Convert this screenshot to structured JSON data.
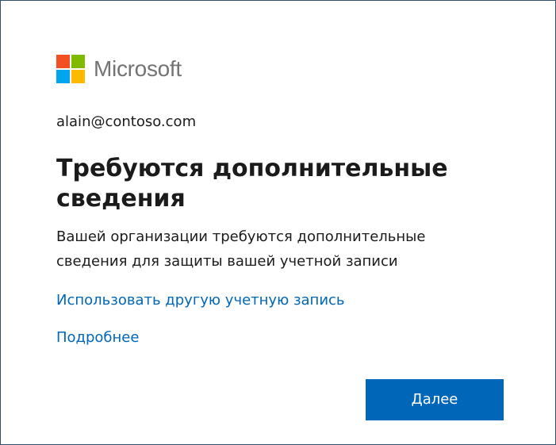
{
  "brand": {
    "name": "Microsoft",
    "logo_colors": [
      "#f25022",
      "#7fba00",
      "#00a4ef",
      "#ffb900"
    ]
  },
  "account": {
    "identity": "alain@contoso.com"
  },
  "heading": {
    "title": "Требуются дополнительные сведения"
  },
  "body": {
    "description": "Вашей организации требуются дополнительные сведения для защиты вашей учетной записи"
  },
  "links": {
    "use_other_account": "Использовать другую учетную запись",
    "learn_more": "Подробнее"
  },
  "actions": {
    "next_label": "Далее"
  },
  "colors": {
    "accent": "#0067b8",
    "text": "#1b1b1b",
    "logo_text": "#737373",
    "border": "#2f4f6b"
  }
}
